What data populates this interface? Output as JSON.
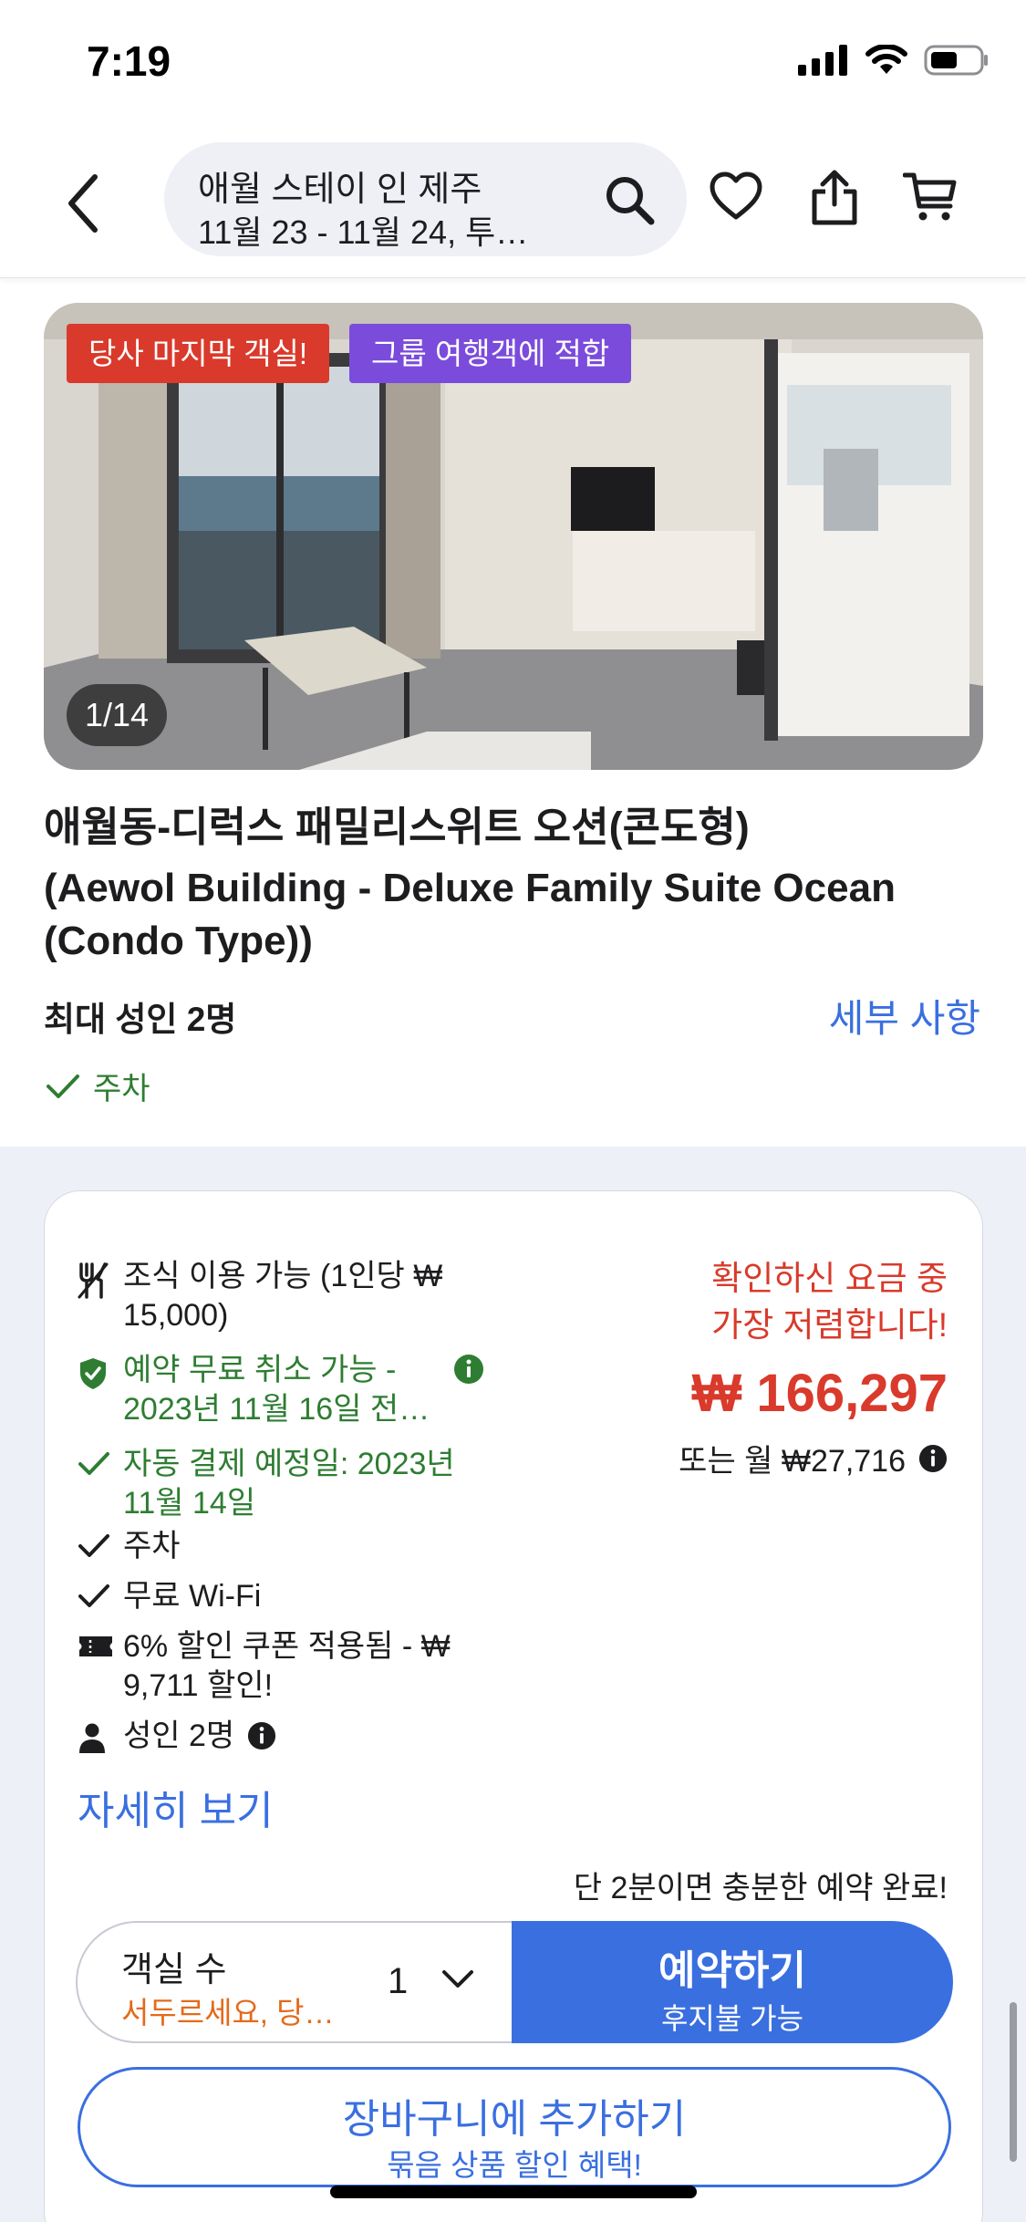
{
  "status_bar": {
    "time": "7:19"
  },
  "header": {
    "search_title": "애월 스테이 인 제주",
    "search_sub": "11월 23 - 11월 24, 투…"
  },
  "hero": {
    "badge_last_room": "당사 마지막 객실!",
    "badge_group": "그룹 여행객에 적합",
    "photo_counter": "1/14"
  },
  "room": {
    "title": "애월동-디럭스 패밀리스위트 오션(콘도형)",
    "subtitle": "(Aewol Building - Deluxe Family Suite Ocean (Condo Type))",
    "capacity": "최대 성인 2명",
    "details_link": "세부 사항",
    "parking": "주차"
  },
  "offer": {
    "features": [
      {
        "icon": "utensils-icon",
        "text": "조식 이용 가능 (1인당 ₩ 15,000)",
        "color": "#1d1d1f"
      },
      {
        "icon": "shield-check-icon",
        "text": "예약 무료 취소 가능 - 2023년 11월 16일 전…",
        "color": "#2e7d32"
      },
      {
        "icon": "check-icon",
        "text": "자동 결제 예정일: 2023년 11월 14일",
        "color": "#2e7d32"
      },
      {
        "icon": "check-icon",
        "text": "주차",
        "color": "#1d1d1f"
      },
      {
        "icon": "check-icon",
        "text": "무료 Wi-Fi",
        "color": "#1d1d1f"
      },
      {
        "icon": "ticket-icon",
        "text": "6% 할인 쿠폰 적용됨 - ₩ 9,711 할인!",
        "color": "#1d1d1f"
      },
      {
        "icon": "person-icon",
        "text": "성인 2명",
        "color": "#1d1d1f"
      }
    ],
    "price_note_line1": "확인하신 요금 중",
    "price_note_line2": "가장 저렴합니다!",
    "price": "₩ 166,297",
    "monthly": "또는 월 ₩27,716",
    "more_link": "자세히 보기",
    "time_note": "단 2분이면 충분한 예약 완료!",
    "room_count_label": "객실 수",
    "room_count_hint": "서두르세요, 당…",
    "room_count_value": "1",
    "book_label": "예약하기",
    "book_sub": "후지불 가능",
    "cart_label": "장바구니에 추가하기",
    "cart_sub": "묶음 상품 할인 혜택!"
  },
  "colors": {
    "accent_blue": "#3a6fe0",
    "alert_red": "#d93a2b",
    "success_green": "#2e7d32",
    "purple_badge": "#7b4cdb"
  }
}
